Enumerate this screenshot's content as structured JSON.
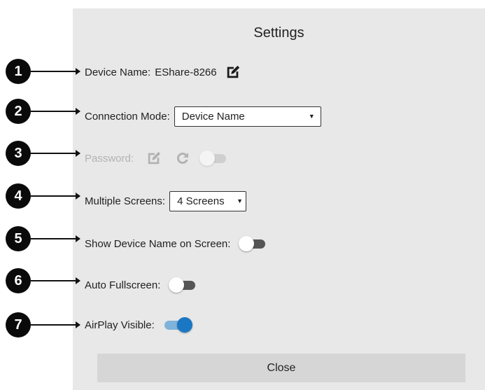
{
  "dialog": {
    "title": "Settings",
    "close_label": "Close"
  },
  "callouts": [
    "1",
    "2",
    "3",
    "4",
    "5",
    "6",
    "7"
  ],
  "device_name": {
    "label": "Device Name:",
    "value": "EShare-8266",
    "edit_icon": "edit-icon"
  },
  "connection_mode": {
    "label": "Connection Mode:",
    "selected": "Device Name"
  },
  "password": {
    "label": "Password:",
    "disabled": true,
    "edit_icon": "edit-icon",
    "refresh_icon": "refresh-icon",
    "toggle_on": false
  },
  "multiple_screens": {
    "label": "Multiple Screens:",
    "selected": "4 Screens"
  },
  "show_device_name": {
    "label": "Show Device Name on Screen:",
    "toggle_on": false
  },
  "auto_fullscreen": {
    "label": "Auto Fullscreen:",
    "toggle_on": false
  },
  "airplay_visible": {
    "label": "AirPlay Visible:",
    "toggle_on": true
  },
  "colors": {
    "panel_bg": "#e8e8e8",
    "accent": "#1a77c4",
    "disabled_text": "#b3b3b3"
  }
}
